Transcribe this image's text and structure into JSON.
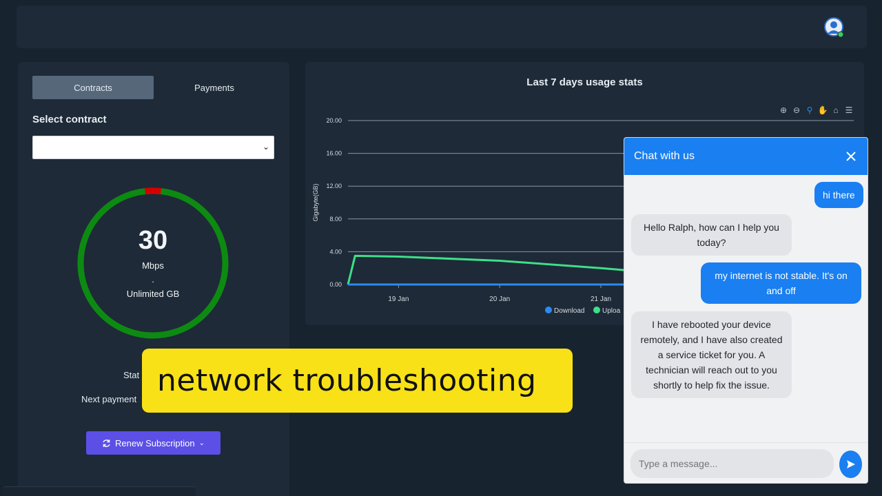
{
  "tabs": [
    {
      "label": "Contracts",
      "active": true
    },
    {
      "label": "Payments",
      "active": false
    }
  ],
  "contract": {
    "label": "Select contract",
    "value": ""
  },
  "gauge": {
    "speed": "30",
    "unit": "Mbps",
    "separator": ".",
    "data": "Unlimited GB",
    "ring_color": "#0d8a12",
    "marker_color": "#d40000"
  },
  "details": {
    "status_label": "Stat",
    "next_payment_label": "Next payment"
  },
  "renew_button": {
    "label": "Renew Subscription",
    "icon": "refresh-icon"
  },
  "chart_toolbar": [
    "zoom-in-icon",
    "zoom-out-icon",
    "zoom-select-icon",
    "pan-icon",
    "home-icon",
    "menu-icon"
  ],
  "chart_data": {
    "type": "line",
    "title": "Last 7 days usage stats",
    "ylabel": "Gigabyte(GB)",
    "ylim": [
      0,
      20
    ],
    "yticks": [
      "0.00",
      "4.00",
      "8.00",
      "12.00",
      "16.00",
      "20.00"
    ],
    "xticks": [
      "19 Jan",
      "20 Jan",
      "21 Jan"
    ],
    "grid": true,
    "legend_position": "bottom",
    "series": [
      {
        "name": "Download",
        "color": "#2a8cf0",
        "points": [
          [
            18.5,
            0.0
          ],
          [
            18.55,
            0.0
          ],
          [
            19,
            0.0
          ],
          [
            20,
            0.0
          ],
          [
            21,
            0.0
          ],
          [
            21.75,
            0.0
          ]
        ]
      },
      {
        "name": "Upload",
        "color": "#3de08a",
        "points": [
          [
            18.5,
            0.0
          ],
          [
            18.57,
            3.5
          ],
          [
            19,
            3.4
          ],
          [
            20,
            2.9
          ],
          [
            21,
            2.0
          ],
          [
            21.75,
            1.2
          ]
        ]
      }
    ],
    "legend_labels": [
      "Download",
      "Uploa"
    ]
  },
  "banner": {
    "text": "network troubleshooting"
  },
  "chat": {
    "title": "Chat with us",
    "messages": [
      {
        "from": "user",
        "text": "hi there"
      },
      {
        "from": "agent",
        "text": "Hello Ralph, how can I help you today?"
      },
      {
        "from": "user",
        "text": "my internet is not stable. It's on and off"
      },
      {
        "from": "agent",
        "text": "I have rebooted your device remotely, and I have also created a service ticket for you. A technician will reach out to you shortly to help fix the issue."
      }
    ],
    "input_placeholder": "Type a message..."
  },
  "colors": {
    "background": "#182330",
    "panel": "#1e2a37",
    "accent": "#1a7ff0",
    "button": "#5b4fe6",
    "banner": "#f8e116"
  }
}
